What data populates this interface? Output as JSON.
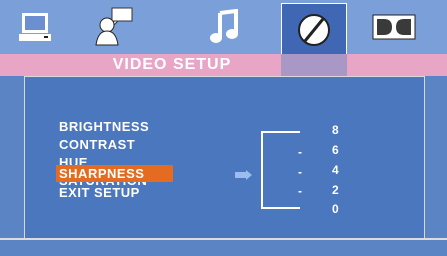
{
  "tabs": [
    {
      "name": "general",
      "icon": "monitor-icon"
    },
    {
      "name": "speaker",
      "icon": "speaker-person-icon"
    },
    {
      "name": "audio",
      "icon": "music-note-icon"
    },
    {
      "name": "video",
      "icon": "video-circle-slash-icon",
      "selected": true
    },
    {
      "name": "dolby",
      "icon": "dolby-icon"
    }
  ],
  "title": "VIDEO SETUP",
  "menu": {
    "items": [
      "BRIGHTNESS",
      "CONTRAST",
      "HUE",
      "SATURATION",
      "SHARPNESS",
      "EXIT SETUP"
    ],
    "selected_index": 4
  },
  "scale": {
    "levels": [
      "8",
      "6",
      "4",
      "2",
      "0"
    ],
    "ticks": [
      "-",
      "-",
      "-"
    ],
    "current_value": 4
  },
  "colors": {
    "background": "#5a84c4",
    "tabbar": "#7b9fd8",
    "title_strip": "#e9a5c5",
    "highlight": "#e46b1f",
    "panel": "#4a77bd"
  }
}
